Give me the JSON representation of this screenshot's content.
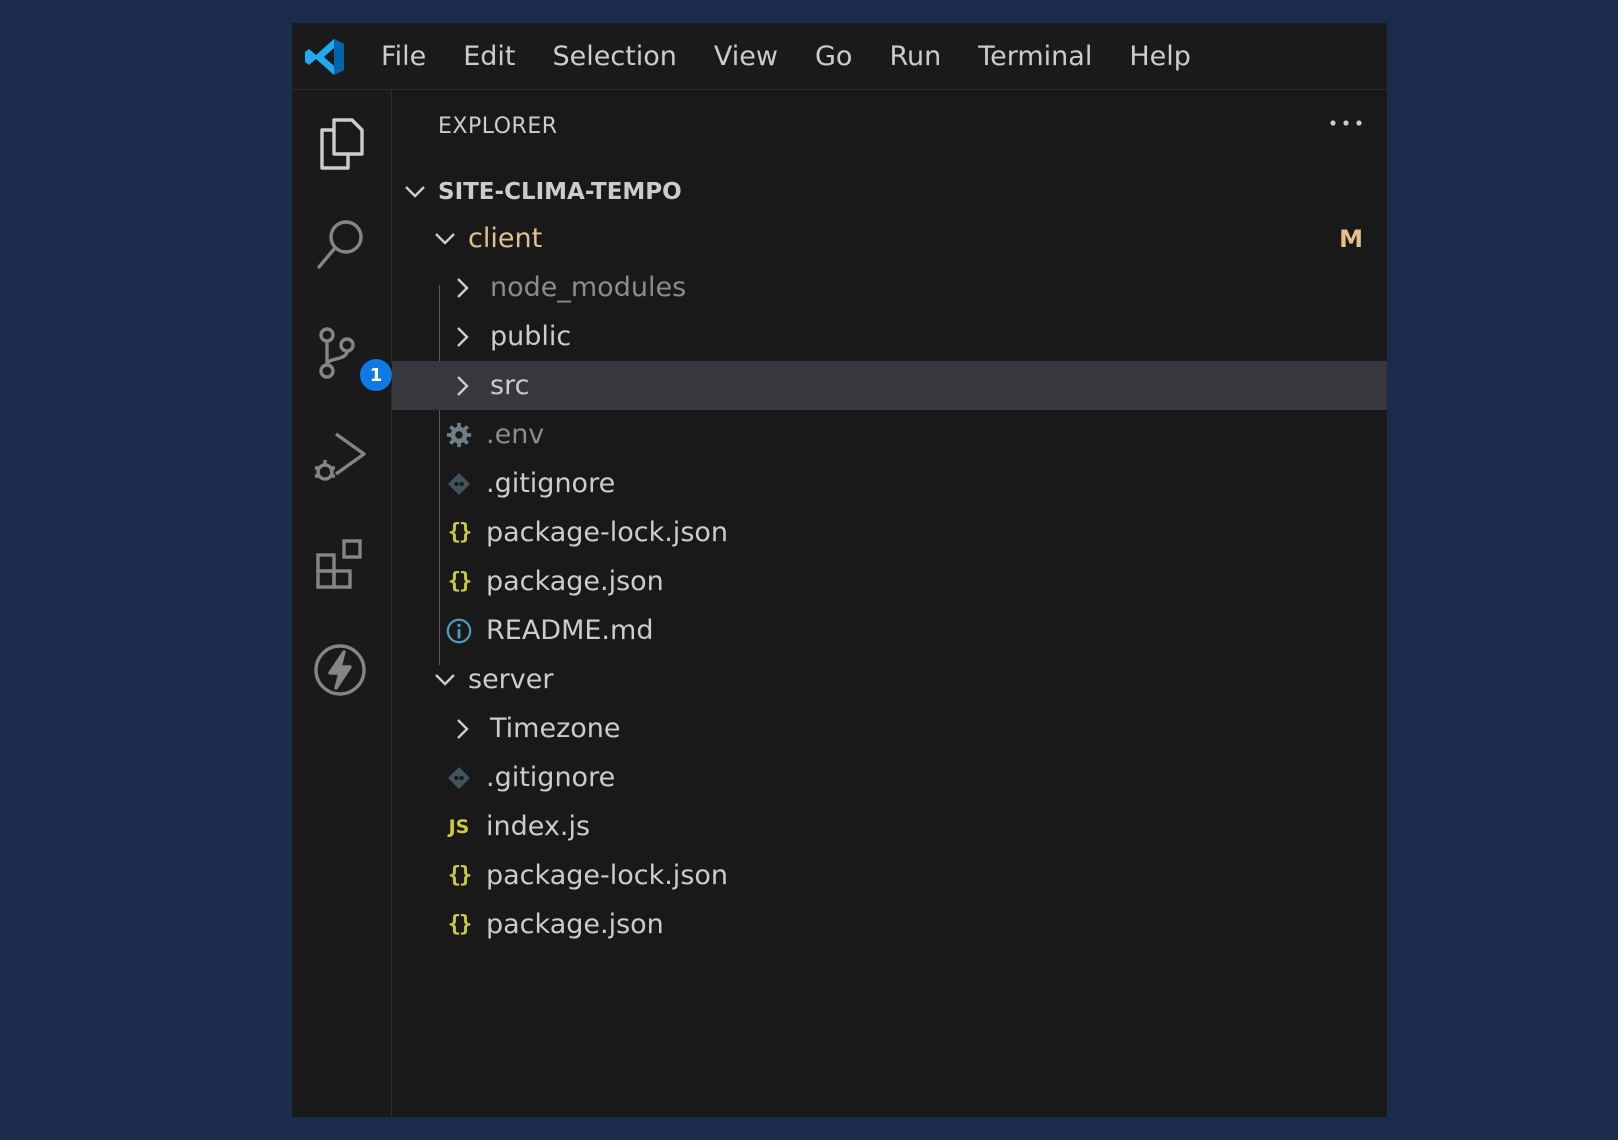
{
  "menubar": {
    "items": [
      "File",
      "Edit",
      "Selection",
      "View",
      "Go",
      "Run",
      "Terminal",
      "Help"
    ]
  },
  "activitybar": {
    "icons": [
      "files-icon",
      "search-icon",
      "source-control-icon",
      "run-debug-icon",
      "extensions-icon",
      "lightning-icon"
    ],
    "source_control_badge": "1",
    "badge_color": "#0f7ae5"
  },
  "explorer": {
    "title": "EXPLORER",
    "root": "SITE-CLIMA-TEMPO",
    "client": {
      "label": "client",
      "decoration": "M",
      "children": {
        "node_modules": "node_modules",
        "public": "public",
        "src": "src",
        "env": ".env",
        "gitignore": ".gitignore",
        "package_lock": "package-lock.json",
        "package": "package.json",
        "readme": "README.md"
      }
    },
    "server": {
      "label": "server",
      "children": {
        "timezone": "Timezone",
        "gitignore": ".gitignore",
        "index": "index.js",
        "package_lock": "package-lock.json",
        "package": "package.json"
      }
    },
    "colors": {
      "modified": "#e2c08d",
      "json": "#cbcb41",
      "info": "#519aba",
      "selected_row": "#37373d"
    }
  }
}
